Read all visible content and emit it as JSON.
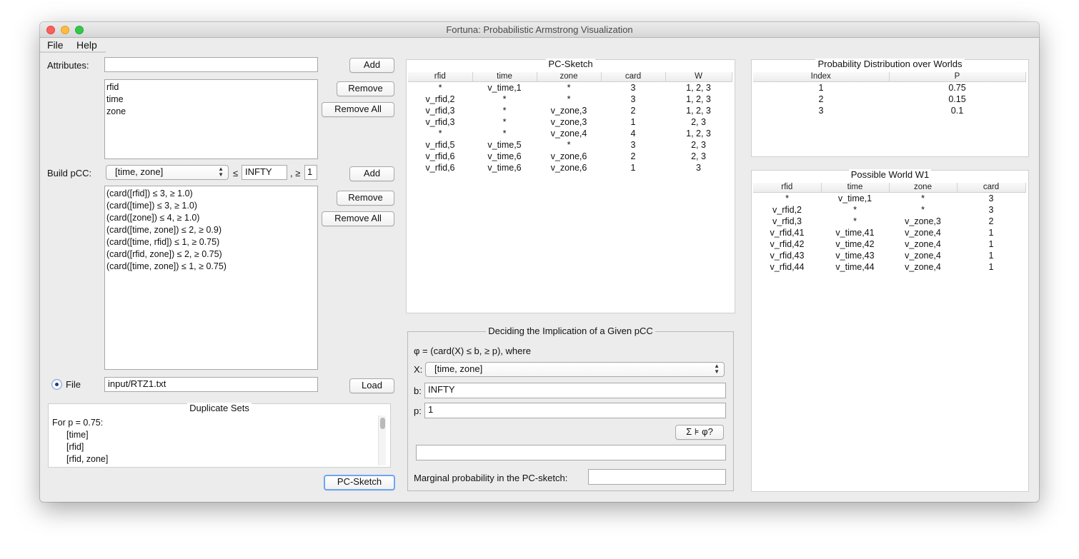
{
  "window": {
    "title": "Fortuna: Probabilistic Armstrong Visualization"
  },
  "menu": {
    "file": "File",
    "help": "Help"
  },
  "attributes": {
    "label": "Attributes:",
    "input_value": "",
    "add": "Add",
    "remove": "Remove",
    "remove_all": "Remove All",
    "items": [
      "rfid",
      "time",
      "zone"
    ]
  },
  "build": {
    "label": "Build pCC:",
    "selected": "[time, zone]",
    "leq": "≤",
    "b_value": "INFTY",
    "geq": ", ≥",
    "p_value": "1",
    "add": "Add",
    "remove": "Remove",
    "remove_all": "Remove All",
    "items": [
      "(card([rfid]) ≤ 3,  ≥ 1.0)",
      "(card([time]) ≤ 3,  ≥ 1.0)",
      "(card([zone]) ≤ 4,  ≥ 1.0)",
      "(card([time, zone]) ≤ 2,  ≥ 0.9)",
      "(card([time, rfid]) ≤ 1,  ≥ 0.75)",
      "(card([rfid, zone]) ≤ 2,  ≥ 0.75)",
      "(card([time, zone]) ≤ 1,  ≥ 0.75)"
    ]
  },
  "file_row": {
    "label": "File",
    "path": "input/RTZ1.txt",
    "load": "Load"
  },
  "duplicates": {
    "title": "Duplicate Sets",
    "lines": [
      "For p = 0.75:",
      "[time]",
      "[rfid]",
      "[rfid, zone]"
    ]
  },
  "pc_sketch_button": "PC-Sketch",
  "pc_sketch": {
    "title": "PC-Sketch",
    "columns": [
      "rfid",
      "time",
      "zone",
      "card",
      "W"
    ],
    "rows": [
      [
        "*",
        "v_time,1",
        "*",
        "3",
        "1, 2, 3"
      ],
      [
        "v_rfid,2",
        "*",
        "*",
        "3",
        "1, 2, 3"
      ],
      [
        "v_rfid,3",
        "*",
        "v_zone,3",
        "2",
        "1, 2, 3"
      ],
      [
        "v_rfid,3",
        "*",
        "v_zone,3",
        "1",
        "2, 3"
      ],
      [
        "*",
        "*",
        "v_zone,4",
        "4",
        "1, 2, 3"
      ],
      [
        "v_rfid,5",
        "v_time,5",
        "*",
        "3",
        "2, 3"
      ],
      [
        "v_rfid,6",
        "v_time,6",
        "v_zone,6",
        "2",
        "2, 3"
      ],
      [
        "v_rfid,6",
        "v_time,6",
        "v_zone,6",
        "1",
        "3"
      ]
    ]
  },
  "implication": {
    "title": "Deciding the Implication of a Given pCC",
    "formula": "φ = (card(X) ≤ b, ≥ p), where",
    "x_label": "X:",
    "x_value": "[time, zone]",
    "b_label": "b:",
    "b_value": "INFTY",
    "p_label": "p:",
    "p_value": "1",
    "check": "Σ ⊧ φ?",
    "result": "",
    "marginal_label": "Marginal probability in the PC-sketch:",
    "marginal_value": ""
  },
  "distribution": {
    "title": "Probability Distribution over Worlds",
    "columns": [
      "Index",
      "P"
    ],
    "rows": [
      [
        "1",
        "0.75"
      ],
      [
        "2",
        "0.15"
      ],
      [
        "3",
        "0.1"
      ]
    ]
  },
  "world": {
    "title": "Possible World W1",
    "columns": [
      "rfid",
      "time",
      "zone",
      "card"
    ],
    "rows": [
      [
        "*",
        "v_time,1",
        "*",
        "3"
      ],
      [
        "v_rfid,2",
        "*",
        "*",
        "3"
      ],
      [
        "v_rfid,3",
        "*",
        "v_zone,3",
        "2"
      ],
      [
        "v_rfid,41",
        "v_time,41",
        "v_zone,4",
        "1"
      ],
      [
        "v_rfid,42",
        "v_time,42",
        "v_zone,4",
        "1"
      ],
      [
        "v_rfid,43",
        "v_time,43",
        "v_zone,4",
        "1"
      ],
      [
        "v_rfid,44",
        "v_time,44",
        "v_zone,4",
        "1"
      ]
    ]
  },
  "colors": {
    "window_bg": "#ececec",
    "traffic_red": "#fc605c",
    "traffic_yellow": "#fdbc40",
    "traffic_green": "#34c84a",
    "focus": "#6ea6f1"
  }
}
